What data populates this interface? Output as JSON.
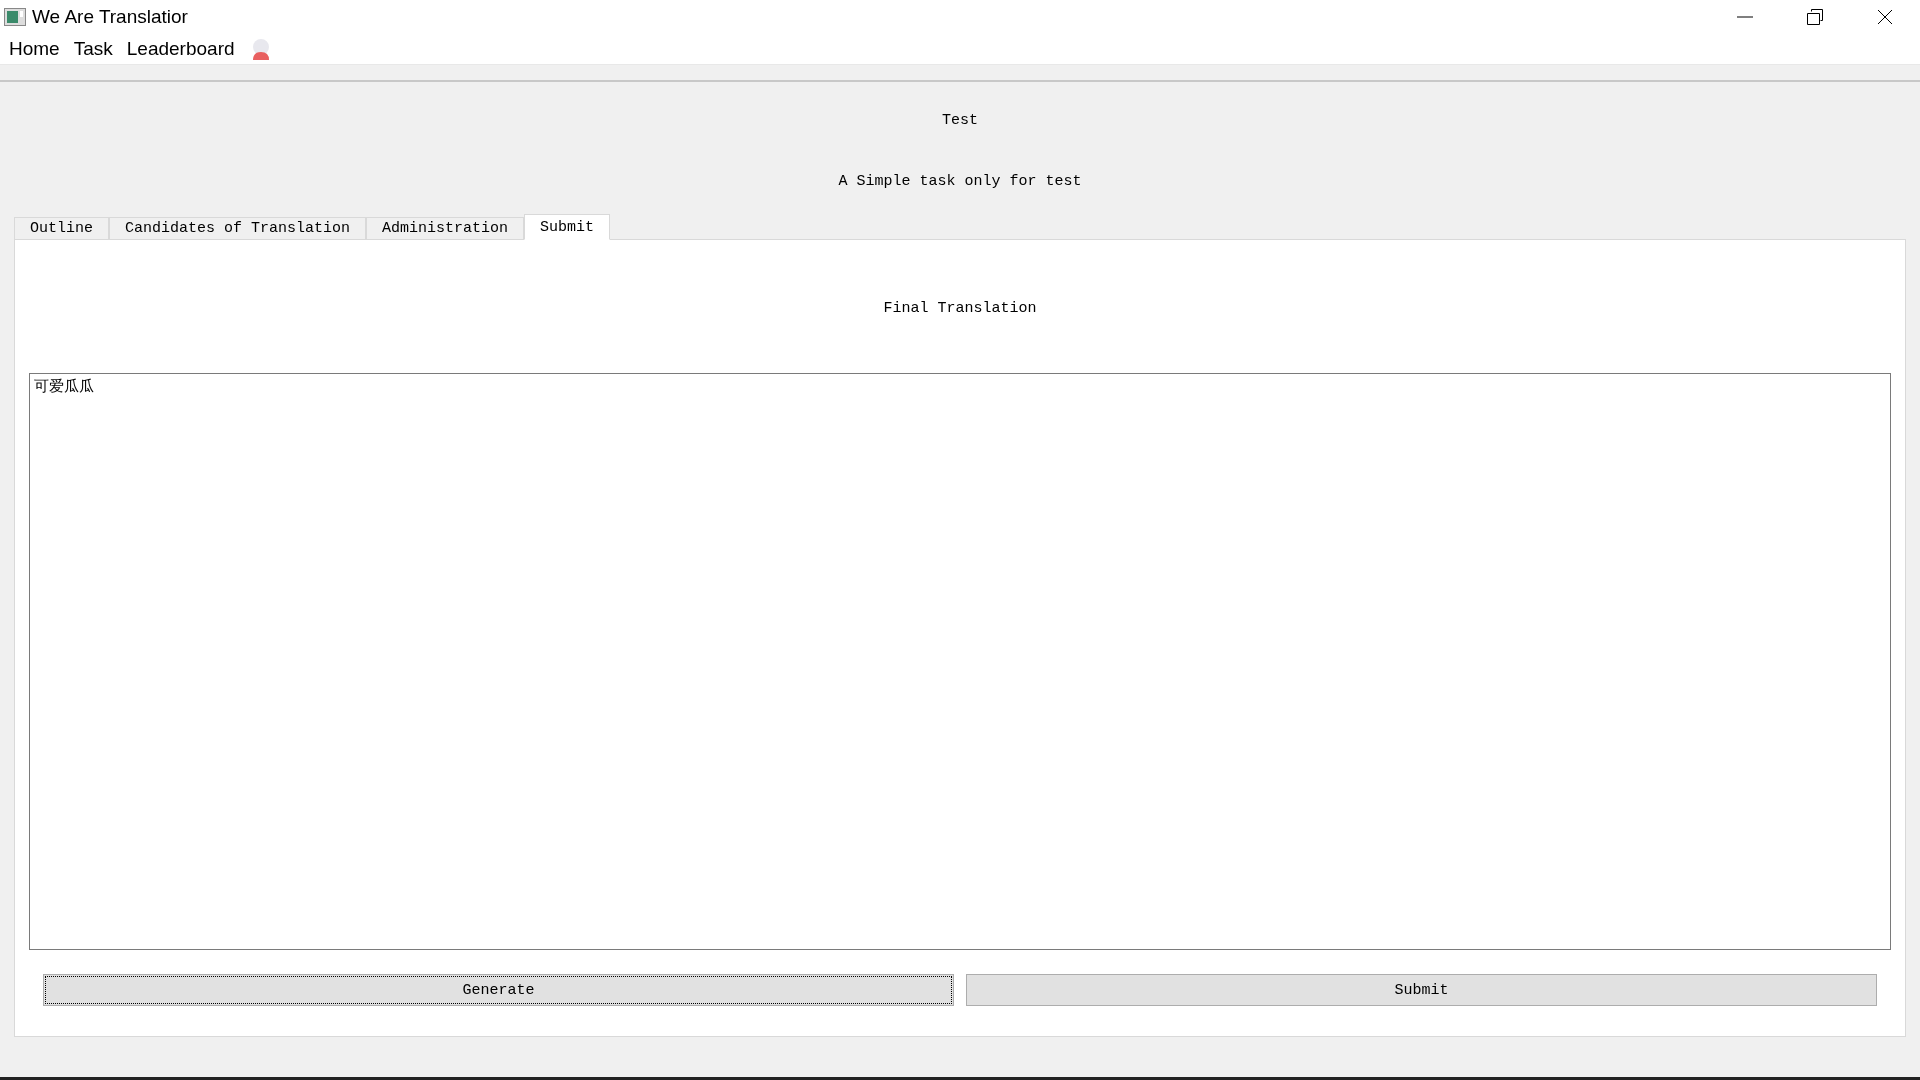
{
  "window": {
    "title": "We Are Translatior"
  },
  "menu": [
    "Home",
    "Task",
    "Leaderboard"
  ],
  "task": {
    "title": "Test",
    "description": "A Simple task only for test"
  },
  "tabs": [
    {
      "label": "Outline",
      "selected": false
    },
    {
      "label": "Candidates of Translation",
      "selected": false
    },
    {
      "label": "Administration",
      "selected": false
    },
    {
      "label": "Submit",
      "selected": true
    }
  ],
  "panel": {
    "heading": "Final Translation",
    "text": "可爱瓜瓜"
  },
  "buttons": [
    {
      "label": "Generate",
      "focused": true
    },
    {
      "label": "Submit",
      "focused": false
    }
  ]
}
